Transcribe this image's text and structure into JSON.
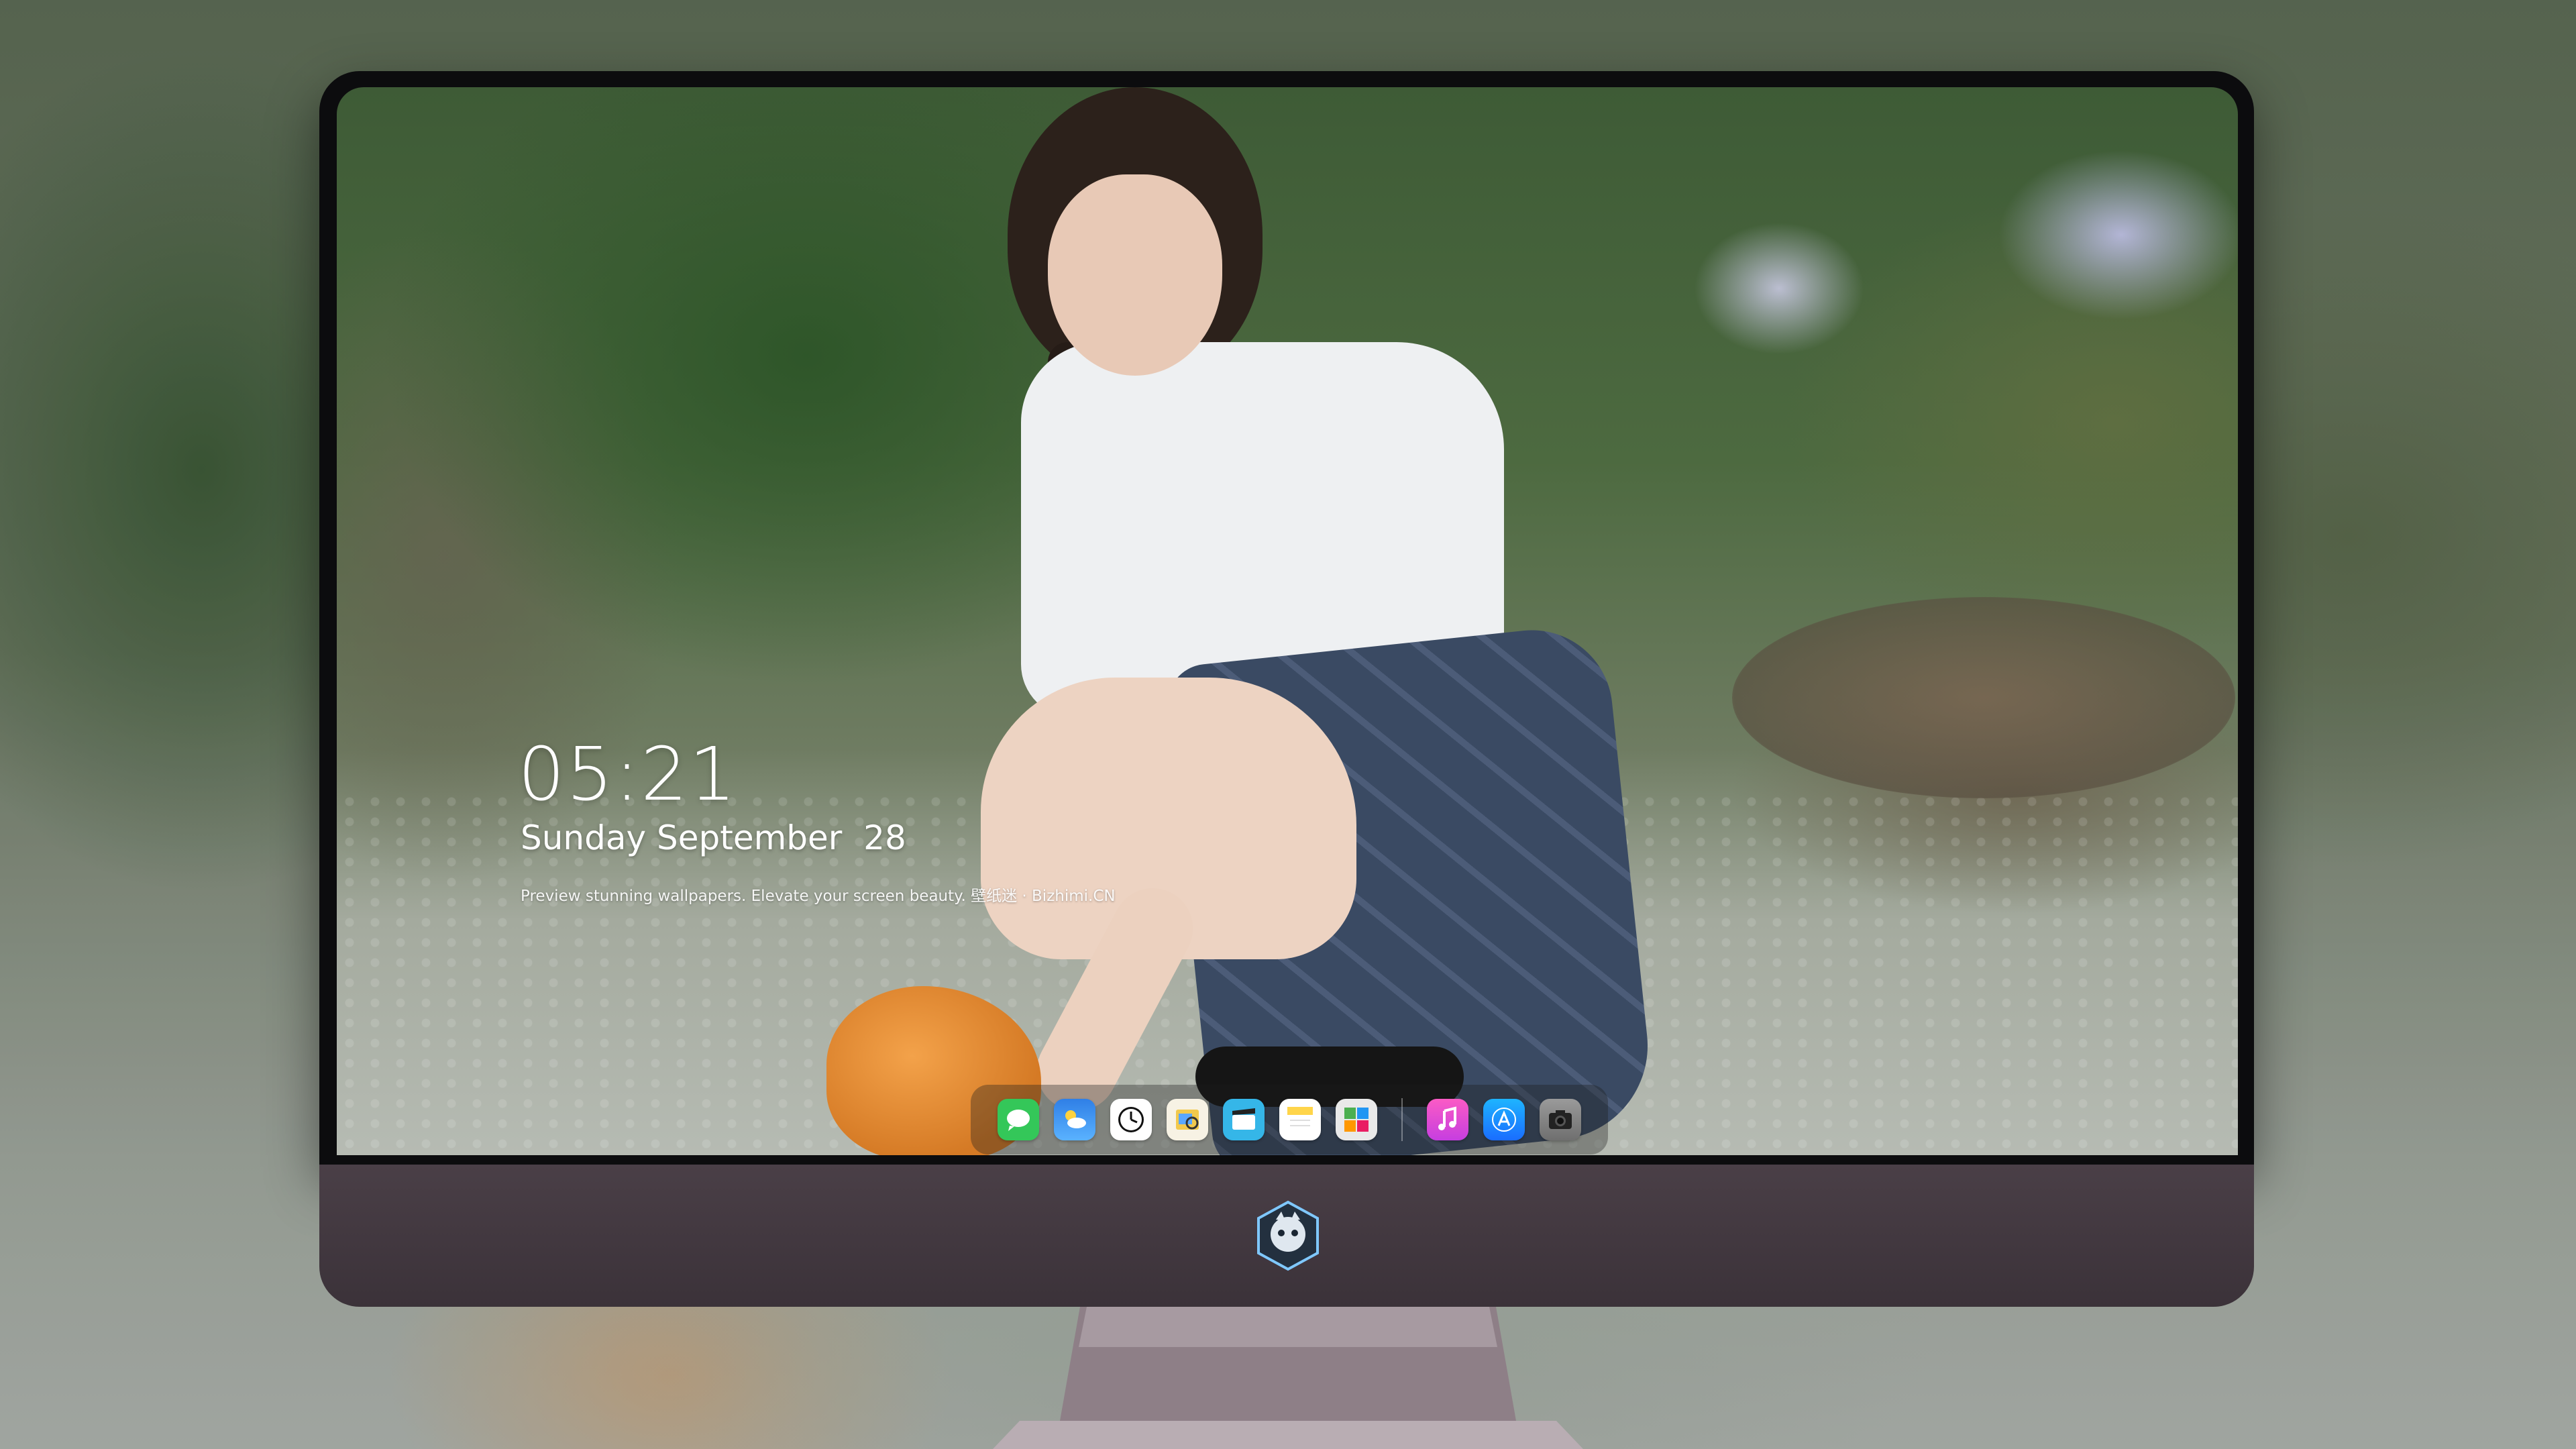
{
  "lockscreen": {
    "time": "05:21",
    "date": "Sunday September  28",
    "tagline": "Preview stunning wallpapers. Elevate your screen beauty. 壁纸迷 · Bizhimi.CN"
  },
  "dock": {
    "apps": [
      {
        "icon": "messages-icon",
        "color": "#34c759"
      },
      {
        "icon": "weather-icon",
        "color": "#2f8ff0"
      },
      {
        "icon": "clock-icon",
        "color": "#ffffff"
      },
      {
        "icon": "preview-icon",
        "color": "#f2c94c"
      },
      {
        "icon": "clips-icon",
        "color": "#35b6e8"
      },
      {
        "icon": "notes-icon",
        "color": "#ffd54a"
      },
      {
        "icon": "photo-booth-icon",
        "color": "#e0e0e0"
      },
      {
        "icon": "music-icon",
        "color": "#f64ea9"
      },
      {
        "icon": "app-store-icon",
        "color": "#1a8cff"
      },
      {
        "icon": "camera-icon",
        "color": "#8c8c8c"
      }
    ]
  },
  "colors": {
    "chin": "#3f353d",
    "bezel": "#0c0c0e"
  }
}
